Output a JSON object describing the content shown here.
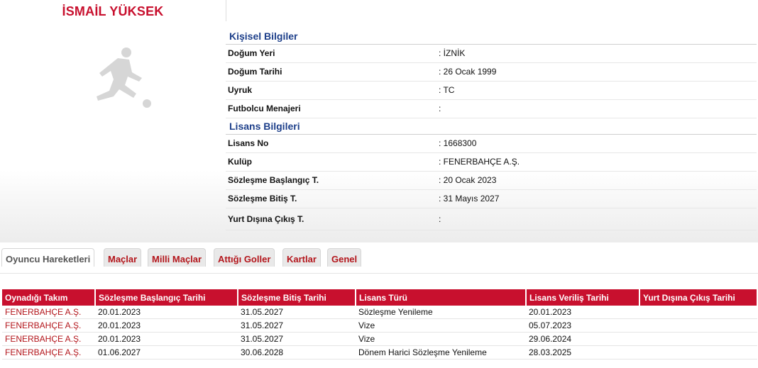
{
  "player": {
    "name": "İSMAİL YÜKSEK"
  },
  "personal": {
    "title": "Kişisel Bilgiler",
    "rows": [
      {
        "label": "Doğum Yeri",
        "value": ": İZNİK"
      },
      {
        "label": "Doğum Tarihi",
        "value": ": 26 Ocak 1999"
      },
      {
        "label": "Uyruk",
        "value": ": TC"
      },
      {
        "label": "Futbolcu Menajeri",
        "value": ":"
      }
    ]
  },
  "license": {
    "title": "Lisans Bilgileri",
    "rows": [
      {
        "label": "Lisans No",
        "value": ": 1668300"
      },
      {
        "label": "Kulüp",
        "value": ": FENERBAHÇE A.Ş."
      },
      {
        "label": "Sözleşme Başlangıç T.",
        "value": ": 20 Ocak 2023"
      },
      {
        "label": "Sözleşme Bitiş T.",
        "value": ": 31 Mayıs 2027"
      },
      {
        "label": "Yurt Dışına Çıkış T.",
        "value": ":"
      }
    ]
  },
  "tabs": [
    {
      "label": "Oyuncu Hareketleri",
      "active": true
    },
    {
      "label": "Maçlar"
    },
    {
      "label": "Milli Maçlar"
    },
    {
      "label": "Attığı Goller"
    },
    {
      "label": "Kartlar"
    },
    {
      "label": "Genel"
    }
  ],
  "table": {
    "headers": [
      "Oynadığı Takım",
      "Sözleşme Başlangıç Tarihi",
      "Sözleşme Bitiş Tarihi",
      "Lisans Türü",
      "Lisans Veriliş Tarihi",
      "Yurt Dışına Çıkış Tarihi"
    ],
    "rows": [
      [
        "FENERBAHÇE A.Ş.",
        "20.01.2023",
        "31.05.2027",
        "Sözleşme Yenileme",
        "20.01.2023",
        ""
      ],
      [
        "FENERBAHÇE A.Ş.",
        "20.01.2023",
        "31.05.2027",
        "Vize",
        "05.07.2023",
        ""
      ],
      [
        "FENERBAHÇE A.Ş.",
        "20.01.2023",
        "31.05.2027",
        "Vize",
        "29.06.2024",
        ""
      ],
      [
        "FENERBAHÇE A.Ş.",
        "01.06.2027",
        "30.06.2028",
        "Dönem Harici Sözleşme Yenileme",
        "28.03.2025",
        ""
      ]
    ]
  },
  "colors": {
    "brand_red": "#c8102e",
    "section_blue": "#1d3f8a"
  },
  "icons": {
    "player_photo": "footballer-silhouette-icon"
  }
}
